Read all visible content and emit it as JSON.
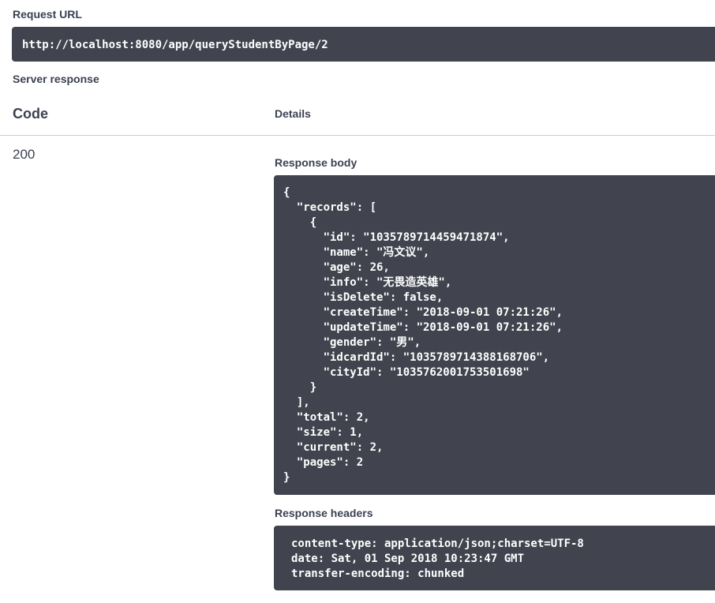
{
  "request_url": {
    "label": "Request URL",
    "value": "http://localhost:8080/app/queryStudentByPage/2"
  },
  "server_response": {
    "label": "Server response",
    "col_code": "Code",
    "col_details": "Details",
    "status_code": "200",
    "body_label": "Response body",
    "body": "{\n  \"records\": [\n    {\n      \"id\": \"1035789714459471874\",\n      \"name\": \"冯文议\",\n      \"age\": 26,\n      \"info\": \"无畏造英雄\",\n      \"isDelete\": false,\n      \"createTime\": \"2018-09-01 07:21:26\",\n      \"updateTime\": \"2018-09-01 07:21:26\",\n      \"gender\": \"男\",\n      \"idcardId\": \"1035789714388168706\",\n      \"cityId\": \"1035762001753501698\"\n    }\n  ],\n  \"total\": 2,\n  \"size\": 1,\n  \"current\": 2,\n  \"pages\": 2\n}",
    "headers_label": "Response headers",
    "headers": "content-type: application/json;charset=UTF-8\ndate: Sat, 01 Sep 2018 10:23:47 GMT\ntransfer-encoding: chunked"
  },
  "colors": {
    "code_background": "#41444e",
    "text": "#3b4151",
    "divider": "#c9ccd1"
  }
}
